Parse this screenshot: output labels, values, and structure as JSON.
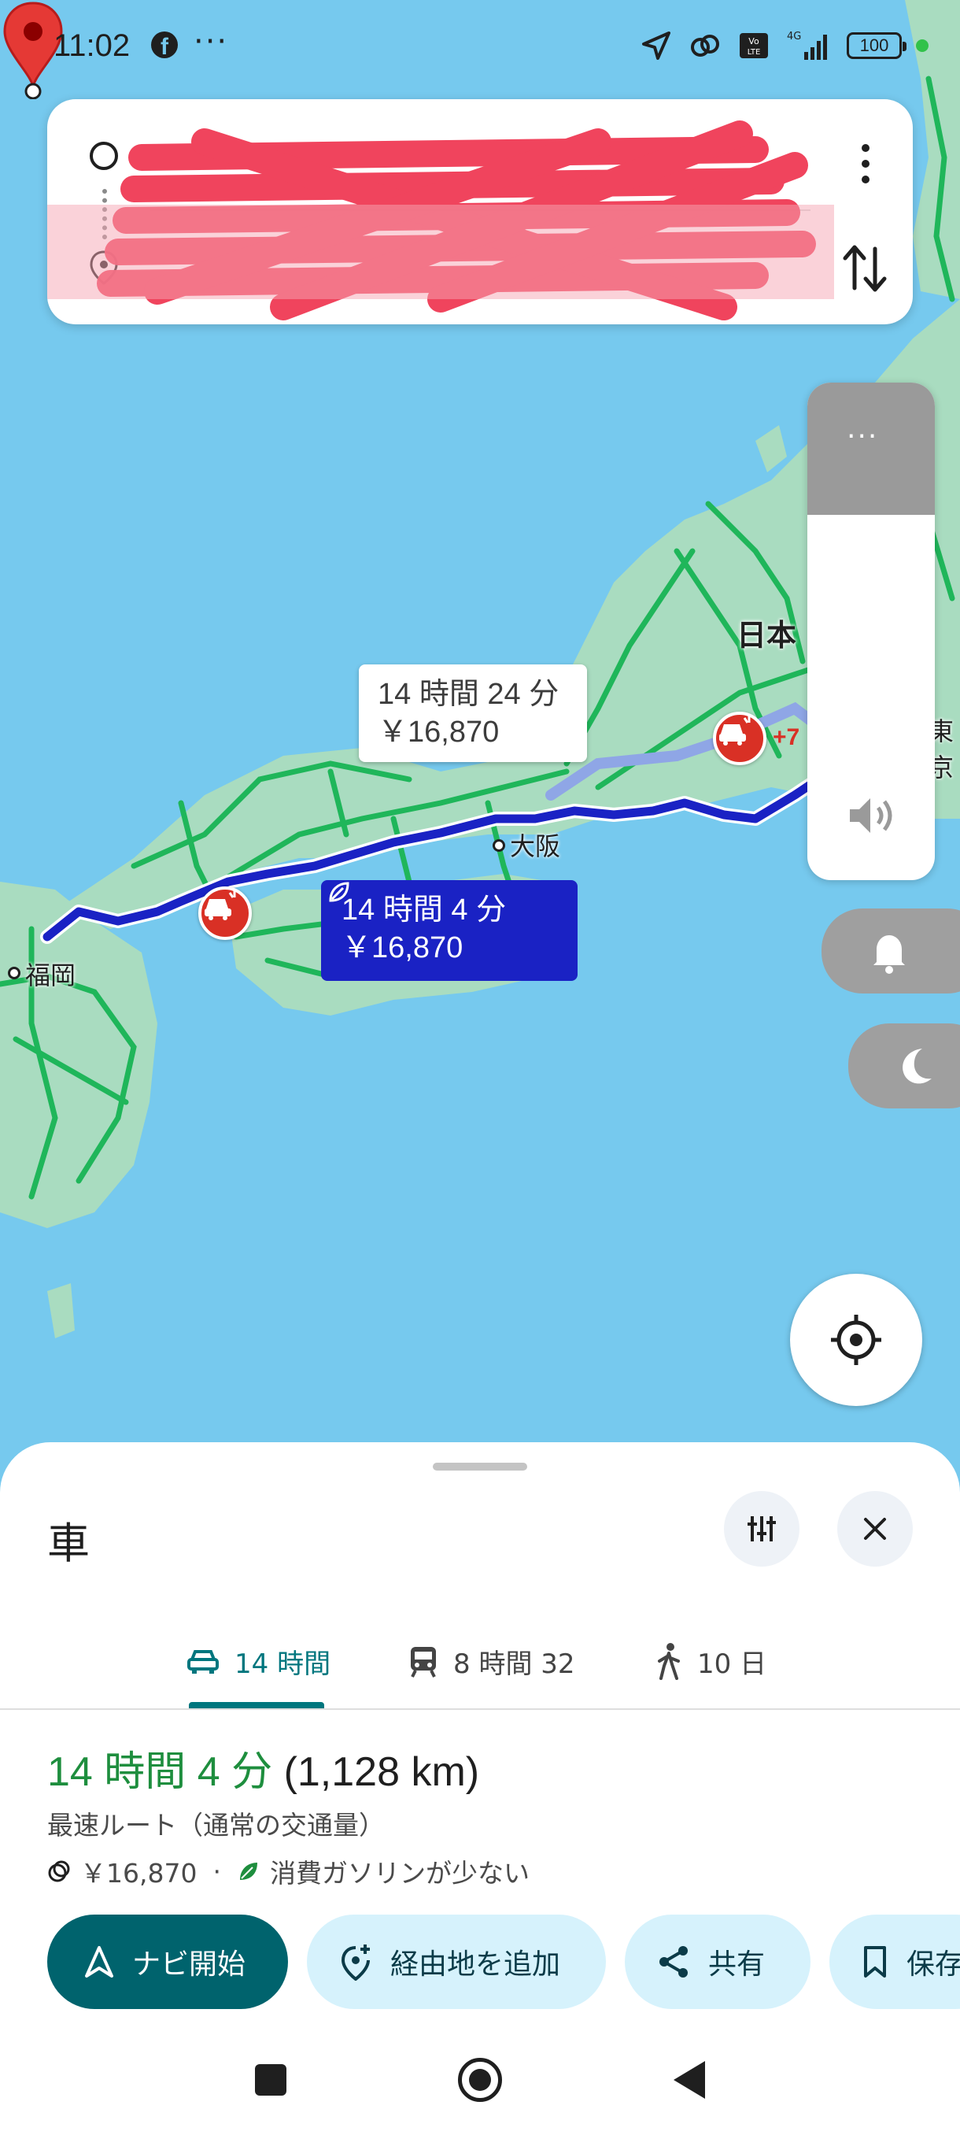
{
  "status_bar": {
    "time": "11:02",
    "more_dots": "···",
    "battery": "100"
  },
  "search": {
    "origin_text": "",
    "destination_text": ""
  },
  "map": {
    "callout_alt_time": "14 時間 24 分",
    "callout_alt_price": "￥16,870",
    "callout_main_time": "14 時間 4 分",
    "callout_main_price": "￥16,870",
    "city_fukuoka": "福岡",
    "city_osaka": "大阪",
    "city_tokyo_partial": "東京",
    "country_label": "日本",
    "incident_count": "+7",
    "colors": {
      "route_main": "#1a22c4",
      "route_alt": "#8fa6e6",
      "land": "#a9dcc0",
      "traffic_green": "#1fb65a",
      "water": "#76c9ee"
    }
  },
  "volume": {
    "menu": "···"
  },
  "sheet": {
    "title": "車",
    "tabs": [
      {
        "label": "14 時間",
        "icon": "car-icon",
        "selected": true
      },
      {
        "label": "8 時間 32",
        "icon": "train-icon",
        "selected": false
      },
      {
        "label": "10 日",
        "icon": "walk-icon",
        "selected": false
      }
    ],
    "route_time": "14 時間 4 分",
    "route_distance": "(1,128 km)",
    "route_desc": "最速ルート（通常の交通量）",
    "route_toll": "￥16,870",
    "route_sep": "·",
    "route_eco": "消費ガソリンが少ない",
    "actions": {
      "nav_start": "ナビ開始",
      "add_stop": "経由地を追加",
      "share": "共有",
      "save": "保存"
    },
    "accent_color": "#00767e"
  }
}
